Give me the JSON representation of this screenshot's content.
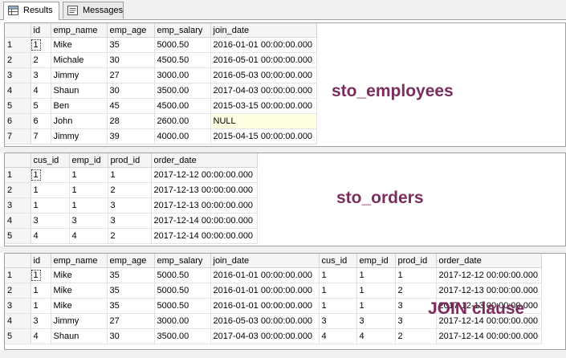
{
  "tabs": {
    "results": "Results",
    "messages": "Messages"
  },
  "labels": {
    "employees": "sto_employees",
    "orders": "sto_orders",
    "join": "JOIN clause"
  },
  "grid1": {
    "columns": [
      "id",
      "emp_name",
      "emp_age",
      "emp_salary",
      "join_date"
    ],
    "rows": [
      [
        "1",
        "Mike",
        "35",
        "5000.50",
        "2016-01-01 00:00:00.000"
      ],
      [
        "2",
        "Michale",
        "30",
        "4500.50",
        "2016-05-01 00:00:00.000"
      ],
      [
        "3",
        "Jimmy",
        "27",
        "3000.00",
        "2016-05-03 00:00:00.000"
      ],
      [
        "4",
        "Shaun",
        "30",
        "3500.00",
        "2017-04-03 00:00:00.000"
      ],
      [
        "5",
        "Ben",
        "45",
        "4500.00",
        "2015-03-15 00:00:00.000"
      ],
      [
        "6",
        "John",
        "28",
        "2600.00",
        "NULL"
      ],
      [
        "7",
        "Jimmy",
        "39",
        "4000.00",
        "2015-04-15 00:00:00.000"
      ]
    ]
  },
  "grid2": {
    "columns": [
      "cus_id",
      "emp_id",
      "prod_id",
      "order_date"
    ],
    "rows": [
      [
        "1",
        "1",
        "1",
        "2017-12-12 00:00:00.000"
      ],
      [
        "1",
        "1",
        "2",
        "2017-12-13 00:00:00.000"
      ],
      [
        "1",
        "1",
        "3",
        "2017-12-13 00:00:00.000"
      ],
      [
        "3",
        "3",
        "3",
        "2017-12-14 00:00:00.000"
      ],
      [
        "4",
        "4",
        "2",
        "2017-12-14 00:00:00.000"
      ]
    ]
  },
  "grid3": {
    "columns": [
      "id",
      "emp_name",
      "emp_age",
      "emp_salary",
      "join_date",
      "cus_id",
      "emp_id",
      "prod_id",
      "order_date"
    ],
    "rows": [
      [
        "1",
        "Mike",
        "35",
        "5000.50",
        "2016-01-01 00:00:00.000",
        "1",
        "1",
        "1",
        "2017-12-12 00:00:00.000"
      ],
      [
        "1",
        "Mike",
        "35",
        "5000.50",
        "2016-01-01 00:00:00.000",
        "1",
        "1",
        "2",
        "2017-12-13 00:00:00.000"
      ],
      [
        "1",
        "Mike",
        "35",
        "5000.50",
        "2016-01-01 00:00:00.000",
        "1",
        "1",
        "3",
        "2017-12-13 00:00:00.000"
      ],
      [
        "3",
        "Jimmy",
        "27",
        "3000.00",
        "2016-05-03 00:00:00.000",
        "3",
        "3",
        "3",
        "2017-12-14 00:00:00.000"
      ],
      [
        "4",
        "Shaun",
        "30",
        "3500.00",
        "2017-04-03 00:00:00.000",
        "4",
        "4",
        "2",
        "2017-12-14 00:00:00.000"
      ]
    ]
  }
}
